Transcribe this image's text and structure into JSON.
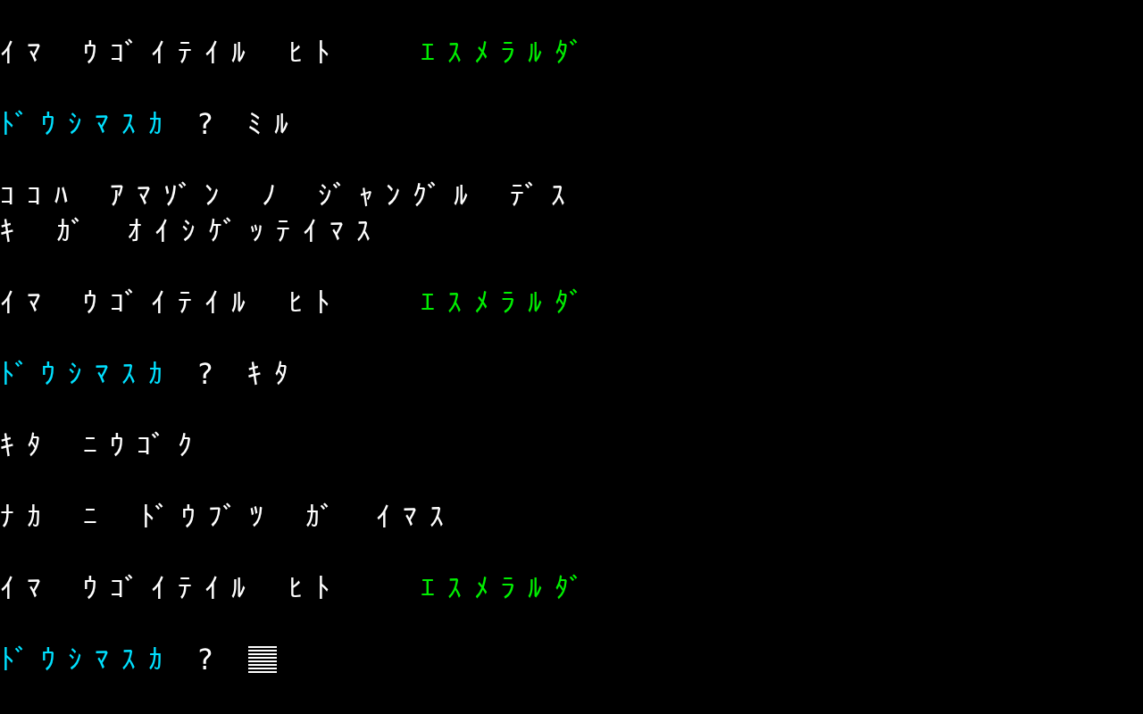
{
  "lines": [
    {
      "kind": "location",
      "label": "ｲﾏ ｳｺﾞｲﾃｲﾙ ﾋﾄ",
      "name": "ｴｽﾒﾗﾙﾀﾞ"
    },
    {
      "kind": "prompt",
      "prompt": "ﾄﾞｳｼﾏｽｶ",
      "mark": "?",
      "input": "ﾐﾙ",
      "cursor": false
    },
    {
      "kind": "text",
      "rows": [
        "ｺｺﾊ ｱﾏｿﾞﾝ ﾉ ｼﾞｬﾝｸﾞﾙ ﾃﾞｽ",
        "ｷ ｶﾞ ｵｲｼｹﾞｯﾃｲﾏｽ"
      ]
    },
    {
      "kind": "location",
      "label": "ｲﾏ ｳｺﾞｲﾃｲﾙ ﾋﾄ",
      "name": "ｴｽﾒﾗﾙﾀﾞ"
    },
    {
      "kind": "prompt",
      "prompt": "ﾄﾞｳｼﾏｽｶ",
      "mark": "?",
      "input": "ｷﾀ",
      "cursor": false
    },
    {
      "kind": "text",
      "rows": [
        "ｷﾀ ﾆｳｺﾞｸ"
      ]
    },
    {
      "kind": "text",
      "rows": [
        "ﾅｶ ﾆ ﾄﾞｳﾌﾞﾂ ｶﾞ ｲﾏｽ"
      ]
    },
    {
      "kind": "blank"
    },
    {
      "kind": "location",
      "label": "ｲﾏ ｳｺﾞｲﾃｲﾙ ﾋﾄ",
      "name": "ｴｽﾒﾗﾙﾀﾞ"
    },
    {
      "kind": "prompt",
      "prompt": "ﾄﾞｳｼﾏｽｶ",
      "mark": "?",
      "cursor": true
    }
  ]
}
